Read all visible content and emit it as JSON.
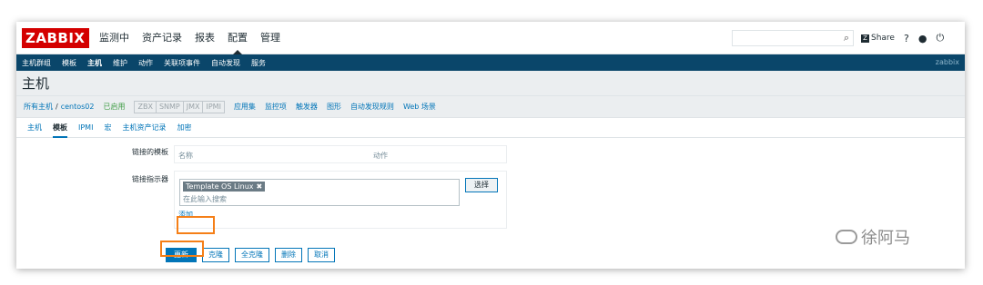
{
  "header": {
    "logo": "ZABBIX",
    "menu": [
      "监测中",
      "资产记录",
      "报表",
      "配置",
      "管理"
    ],
    "active_menu": "配置",
    "share": "Share",
    "help": "?",
    "user_icon": "user-icon",
    "logout_icon": "power-icon"
  },
  "subnav": {
    "items": [
      "主机群组",
      "模板",
      "主机",
      "维护",
      "动作",
      "关联项事件",
      "自动发现",
      "服务"
    ],
    "active": "主机",
    "user": "zabbix"
  },
  "page": {
    "title": "主机"
  },
  "breadcrumbs": {
    "all_hosts": "所有主机",
    "sep": "/",
    "host": "centos02",
    "status": "已启用",
    "availability": [
      "ZBX",
      "SNMP",
      "JMX",
      "IPMI"
    ],
    "links": [
      "应用集",
      "监控项",
      "触发器",
      "图形",
      "自动发现规则",
      "Web 场景"
    ]
  },
  "tabs": [
    "主机",
    "模板",
    "IPMI",
    "宏",
    "主机资产记录",
    "加密"
  ],
  "active_tab": "模板",
  "form": {
    "linked_templates_label": "链接的模板",
    "col_name": "名称",
    "col_action": "动作",
    "link_indicator_label": "链接指示器",
    "chip": "Template OS Linux",
    "chip_remove": "✖",
    "placeholder": "在此输入搜索",
    "select_button": "选择",
    "add_link": "添加"
  },
  "buttons": [
    "更新",
    "克隆",
    "全克隆",
    "删除",
    "取消"
  ],
  "watermark": "徐阿马",
  "colors": {
    "brand": "#d40000",
    "nav": "#0a466a",
    "link": "#0275b8",
    "highlight": "#f57f17",
    "enabled": "#429e47"
  }
}
